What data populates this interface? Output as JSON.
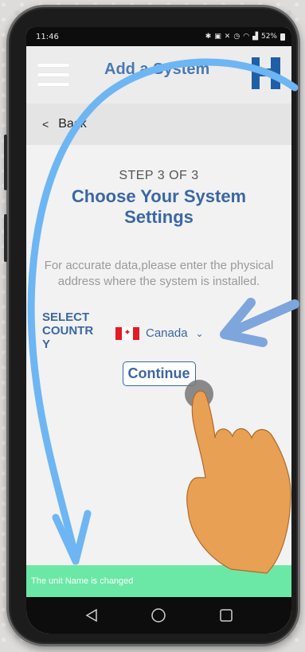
{
  "status_bar": {
    "time": "11:46",
    "battery": "52%"
  },
  "app_bar": {
    "title": "Add a System"
  },
  "back": {
    "label": "Back"
  },
  "step": {
    "label": "STEP 3 OF 3"
  },
  "heading": "Choose Your System Settings",
  "description": "For accurate data,please enter the physical address where the system is installed.",
  "country": {
    "label": "SELECT COUNTRY",
    "selected": "Canada"
  },
  "continue": {
    "label": "Continue"
  },
  "toast": {
    "message": "The unit Name is changed"
  },
  "colors": {
    "accent": "#3b67a4",
    "toast": "#6be8a6",
    "arrow": "#6db6f3",
    "hand": "#e8a054"
  }
}
